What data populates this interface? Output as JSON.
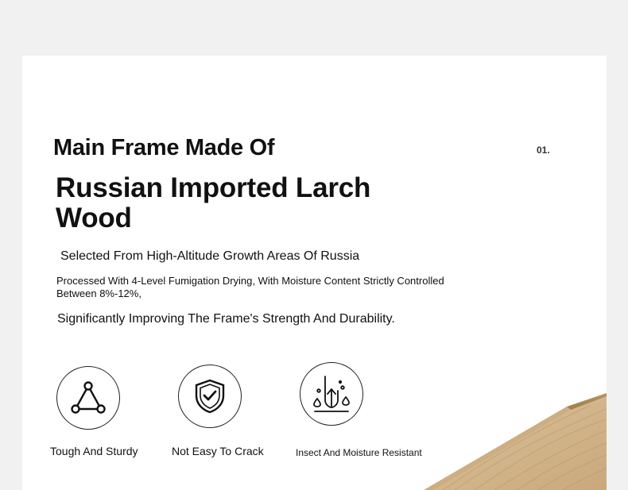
{
  "header": {
    "kicker": "Main Frame Made Of",
    "headline_line1": "Russian Imported Larch",
    "headline_line2": "Wood",
    "index": "01."
  },
  "body": {
    "sub1": "Selected From High-Altitude Growth Areas Of Russia",
    "para_line1": "Processed With 4-Level Fumigation Drying, With Moisture Content Strictly Controlled",
    "para_line2": "Between 8%-12%,",
    "sub2": "Significantly Improving The Frame's Strength And Durability."
  },
  "features": [
    {
      "label": "Tough And Sturdy",
      "icon": "triangle-nodes-icon"
    },
    {
      "label": "Not Easy To Crack",
      "icon": "shield-check-icon"
    },
    {
      "label": "Insect And Moisture Resistant",
      "icon": "moisture-insect-icon"
    }
  ],
  "colors": {
    "background": "#f1f1f1",
    "card": "#ffffff",
    "text": "#111111",
    "wood": "#d4b68c"
  }
}
